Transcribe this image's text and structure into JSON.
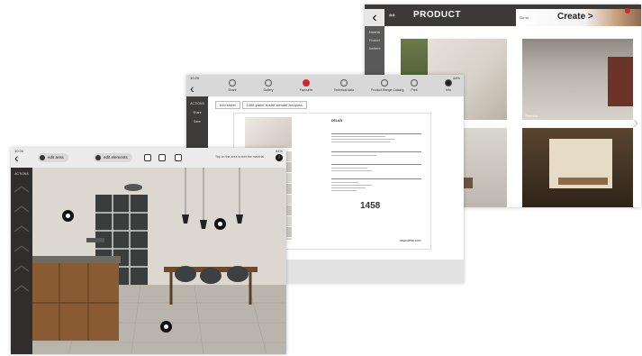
{
  "back_screen": {
    "status": {
      "time": "10:26",
      "battery": "44%"
    },
    "title": "PRODUCT",
    "create_small": "Go to",
    "create_label": "Create",
    "create_chevron": ">",
    "back_icon": "‹",
    "sidebar": [
      "Material",
      "Product",
      "Ambient"
    ],
    "tiles": [
      {
        "caption": "Ilustre ST"
      },
      {
        "caption": "Travertin"
      },
      {
        "caption": ""
      },
      {
        "caption": ""
      }
    ]
  },
  "middle_screen": {
    "status": {
      "time": "10:26",
      "battery": "44%"
    },
    "toolbar": [
      {
        "label": "Share"
      },
      {
        "label": "Gallery"
      },
      {
        "label": "Favourite"
      },
      {
        "label": "Technical data"
      },
      {
        "label": "Product Range Catalog"
      },
      {
        "label": "Print"
      },
      {
        "label": "Info"
      }
    ],
    "sidebar": [
      "ACTIONS",
      "Share",
      "Save"
    ],
    "tabs": [
      "Info sheet",
      "1458 panel Ilustre slender Anupura"
    ],
    "doc": {
      "brand": "DELAR",
      "code": "1458",
      "footer": "www.delar.com"
    }
  },
  "front_screen": {
    "status": {
      "time": "10:26",
      "battery": "44%"
    },
    "back_icon": "‹",
    "pills": [
      "edit area",
      "edit elements"
    ],
    "hint": "Tap on the area to edit the material",
    "sidebar_tag": "ACTIONS"
  },
  "next_arrow": "›"
}
